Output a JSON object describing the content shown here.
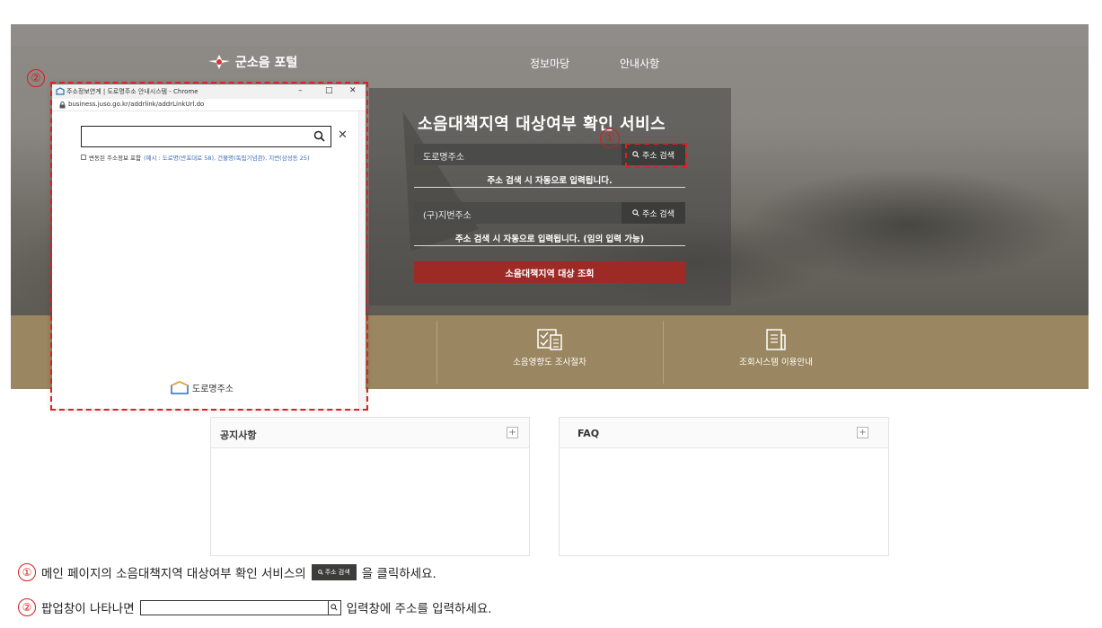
{
  "header": {
    "logo_text": "군소음 포털",
    "nav": [
      "정보마당",
      "안내사항"
    ]
  },
  "search_panel": {
    "title": "소음대책지역 대상여부 확인 서비스",
    "road_address_label": "도로명주소",
    "road_search_button": "주소 검색",
    "road_hint": "주소 검색 시 자동으로 입력됩니다.",
    "lot_address_label": "(구)지번주소",
    "lot_search_button": "주소 검색",
    "lot_hint": "주소 검색 시 자동으로 입력됩니다. (임의 입력 가능)",
    "submit_button": "소음대책지역 대상 조회"
  },
  "quick_links": [
    {
      "label": "소음영향도 조사절차",
      "icon": "checklist-icon"
    },
    {
      "label": "조회시스템 이용안내",
      "icon": "document-icon"
    }
  ],
  "boards": [
    {
      "title": "공지사항",
      "more": "+"
    },
    {
      "title": "FAQ",
      "more": "+"
    }
  ],
  "popup": {
    "window_title": "주소정보연계 | 도로명주소 안내시스템 - Chrome",
    "url": "business.juso.go.kr/addrlink/addrLinkUrl.do",
    "search_value": "",
    "checkbox_label": "변동된 주소정보 포함",
    "example_text": "(예시 : 도로명(반포대로 58), 건물명(독립기념관), 지번(삼성동 25)",
    "footer_logo_text": "도로명주소",
    "win_min": "–",
    "win_max": "□",
    "win_close": "✕",
    "clear": "✕"
  },
  "markers": {
    "one": "①",
    "two": "②"
  },
  "instructions": {
    "step1_before": "메인 페이지의 소음대책지역 대상여부 확인 서비스의",
    "step1_button": "주소 검색",
    "step1_after": "을 클릭하세요.",
    "step2_before": "팝업창이 나타나면",
    "step2_after": "입력창에 주소를 입력하세요."
  },
  "colors": {
    "accent_red": "#9e2a26",
    "gold_band": "#9a8660",
    "annotation_red": "#e02020"
  }
}
